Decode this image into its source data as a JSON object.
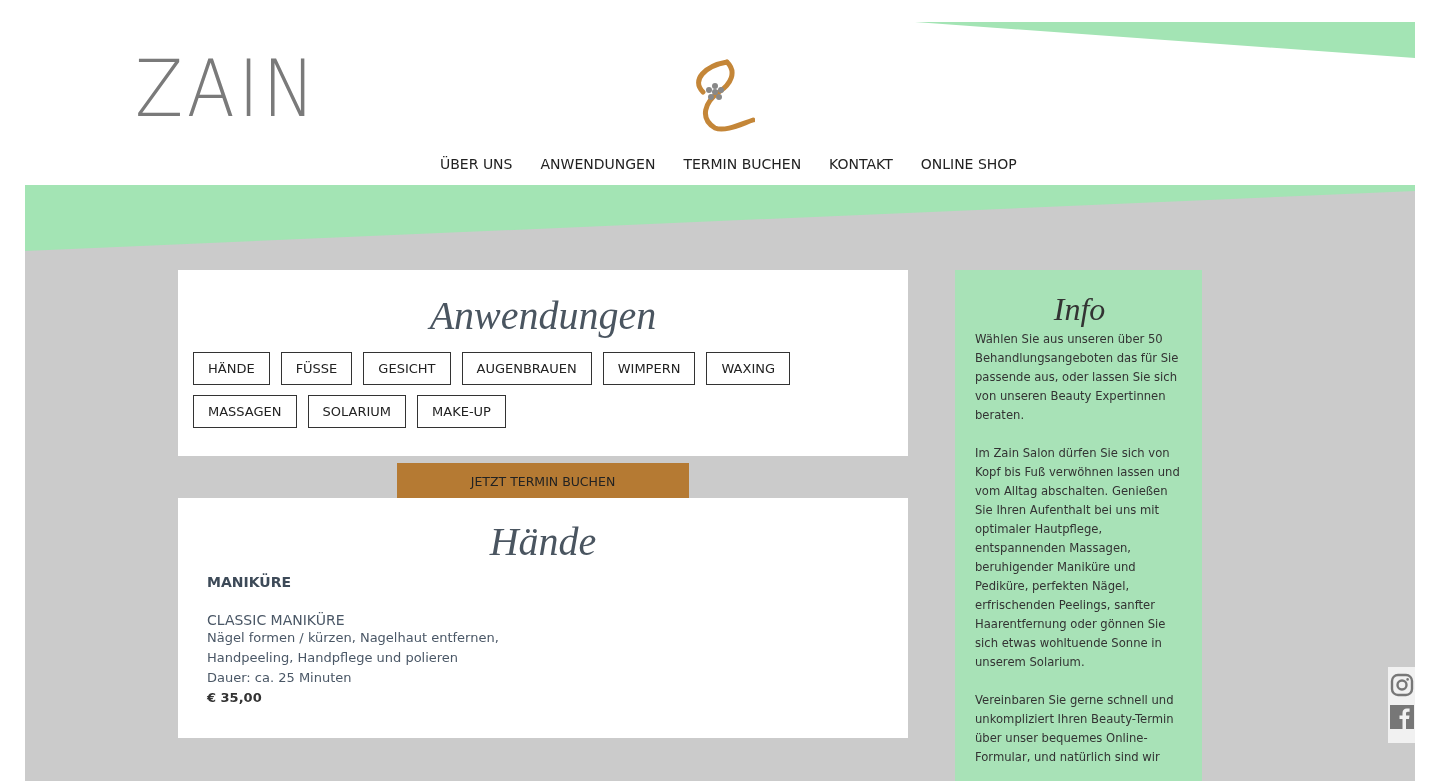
{
  "logo": {
    "text": "ZAIN"
  },
  "nav": [
    {
      "label": "ÜBER UNS"
    },
    {
      "label": "ANWENDUNGEN"
    },
    {
      "label": "TERMIN BUCHEN"
    },
    {
      "label": "KONTAKT"
    },
    {
      "label": "ONLINE SHOP"
    }
  ],
  "treatments_card": {
    "title": "Anwendungen",
    "categories": [
      {
        "label": "HÄNDE"
      },
      {
        "label": "FÜSSE"
      },
      {
        "label": "GESICHT"
      },
      {
        "label": "AUGENBRAUEN"
      },
      {
        "label": "WIMPERN"
      },
      {
        "label": "WAXING"
      },
      {
        "label": "MASSAGEN"
      },
      {
        "label": "SOLARIUM"
      },
      {
        "label": "MAKE-UP"
      }
    ],
    "cta": "JETZT TERMIN BUCHEN"
  },
  "section": {
    "title": "Hände",
    "heading": "MANIKÜRE",
    "item": {
      "name": "CLASSIC MANIKÜRE",
      "description": "Nägel formen / kürzen, Nagelhaut entfernen, Handpeeling, Handpflege und polieren",
      "duration": "Dauer: ca. 25 Minuten",
      "price": "€ 35,00"
    }
  },
  "info": {
    "title": "Info",
    "paragraphs": [
      "Wählen Sie aus unseren über 50 Behandlungsangeboten das für Sie passende aus, oder lassen Sie sich von unseren Beauty Expertinnen beraten.",
      "Im Zain Salon dürfen Sie sich von Kopf bis Fuß verwöhnen lassen und vom Alltag abschalten. Genießen Sie Ihren Aufenthalt bei uns mit optimaler Hautpflege, entspannenden Massagen, beruhigender Maniküre und Pediküre, perfekten Nägel, erfrischenden Peelings, sanfter Haarentfernung oder gönnen Sie sich etwas wohltuende Sonne in unserem Solarium.",
      "Vereinbaren Sie gerne schnell und unkompliziert Ihren Beauty-Termin über unser bequemes Online-Formular, und natürlich sind wir"
    ]
  }
}
